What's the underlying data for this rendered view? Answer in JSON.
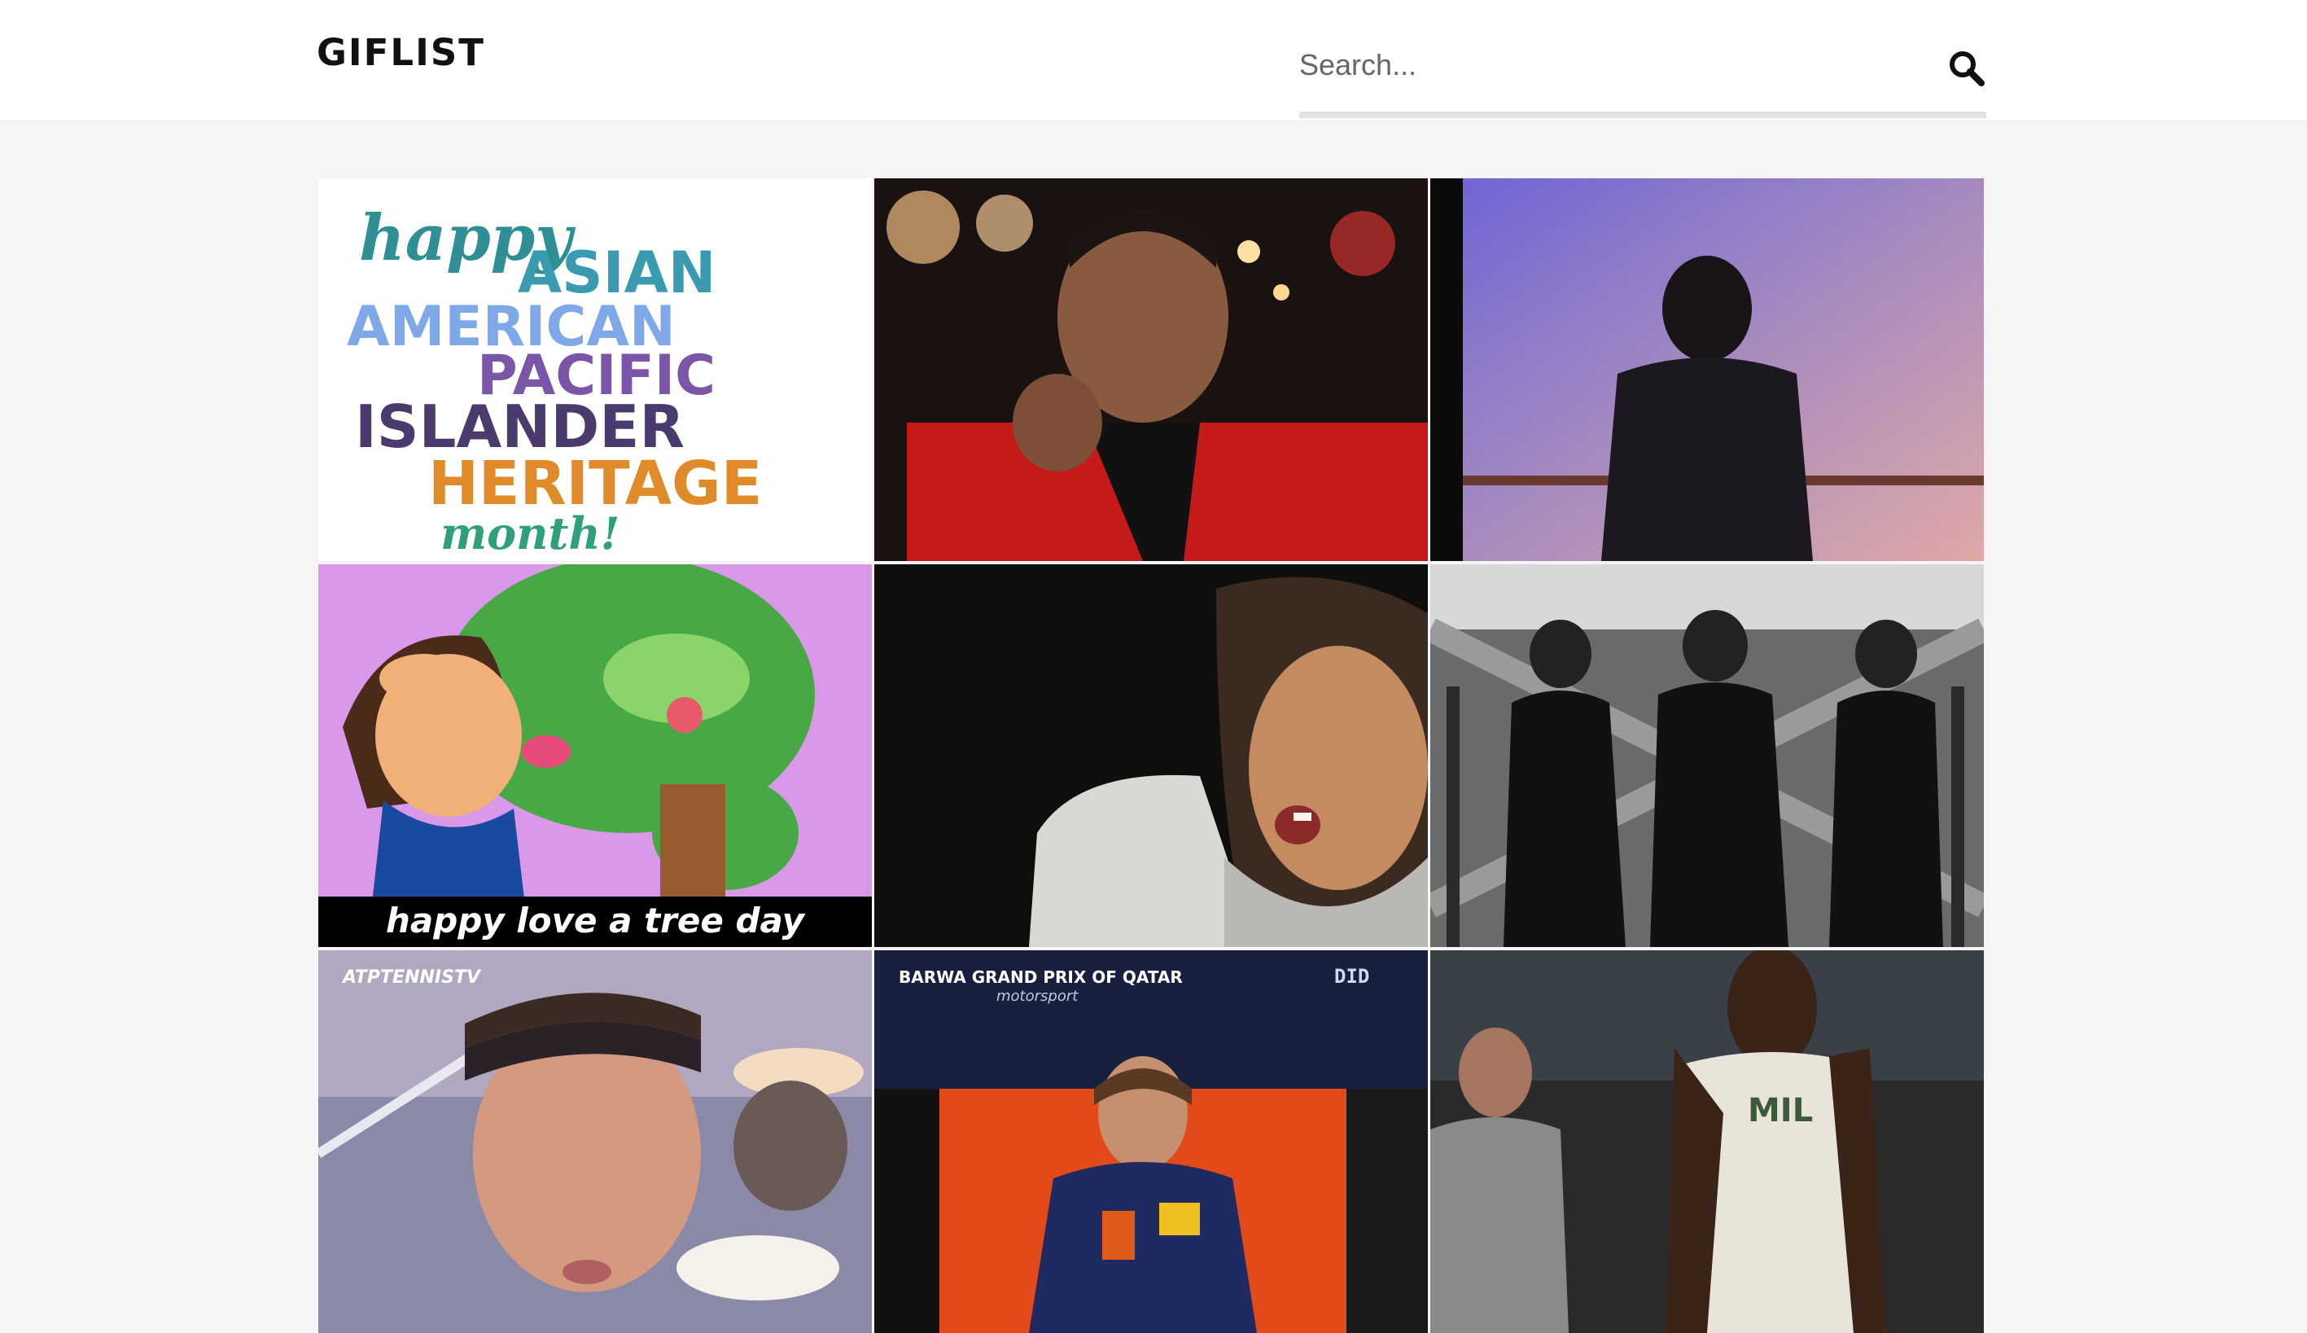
{
  "header": {
    "logo": "GIFLIST",
    "search": {
      "placeholder": "Search...",
      "value": ""
    }
  },
  "icons": {
    "search": "search-icon"
  },
  "gifs": [
    {
      "name": "gif-heritage-month",
      "lines": [
        "happy",
        "ASIAN",
        "AMERICAN",
        "PACIFIC",
        "ISLANDER",
        "HERITAGE",
        "month!"
      ]
    },
    {
      "name": "gif-man-red-jacket"
    },
    {
      "name": "gif-dancer-purple"
    },
    {
      "name": "gif-love-a-tree",
      "caption": "happy love a tree day"
    },
    {
      "name": "gif-woman-eating"
    },
    {
      "name": "gif-three-dancers"
    },
    {
      "name": "gif-tennis",
      "watermark": "ATPTENNISTV"
    },
    {
      "name": "gif-motogp",
      "banner": "BARWA GRAND PRIX OF QATAR",
      "banner_sub": "motorsport",
      "corner": "DID"
    },
    {
      "name": "gif-basketball",
      "jersey": "MIL"
    }
  ]
}
